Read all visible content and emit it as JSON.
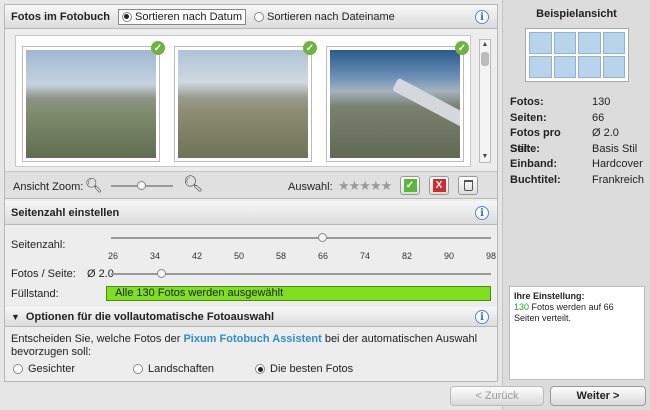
{
  "photos_section": {
    "title": "Fotos im Fotobuch",
    "sort_by_date": "Sortieren nach Datum",
    "sort_by_name": "Sortieren nach Dateiname"
  },
  "toolbar": {
    "zoom_label": "Ansicht Zoom:",
    "selection_label": "Auswahl:",
    "rating_stars": "★★★★★",
    "zoom_level": 0.5
  },
  "pages_section": {
    "title": "Seitenzahl einstellen",
    "pages_label": "Seitenzahl:",
    "ticks": [
      "26",
      "34",
      "42",
      "50",
      "58",
      "66",
      "74",
      "82",
      "90",
      "98"
    ],
    "pages_value": 66,
    "photos_per_page_label": "Fotos / Seite:",
    "photos_per_page_value": "Ø 2.0",
    "fill_label": "Füllstand:",
    "fill_text": "Alle 130 Fotos werden ausgewählt"
  },
  "options_section": {
    "title": "Optionen für die vollautomatische Fotoauswahl",
    "desc_before": "Entscheiden Sie, welche Fotos der ",
    "desc_brand": "Pixum Fotobuch Assistent",
    "desc_after": " bei der automatischen Auswahl bevorzugen soll:",
    "options": [
      "Gesichter",
      "Landschaften",
      "Die besten Fotos"
    ],
    "selected": "Die besten Fotos"
  },
  "sidebar": {
    "title": "Beispielansicht",
    "props": [
      {
        "key": "Fotos:",
        "value": "130"
      },
      {
        "key": "Seiten:",
        "value": "66"
      },
      {
        "key": "Fotos pro Seite:",
        "value": "Ø 2.0"
      },
      {
        "key": "Stil:",
        "value": "Basis Stil"
      },
      {
        "key": "Einband:",
        "value": "Hardcover"
      },
      {
        "key": "Buchtitel:",
        "value": "Frankreich"
      }
    ],
    "setting_title": "Ihre Einstellung:",
    "setting_count": "130",
    "setting_text": " Fotos werden auf 66 Seiten verteilt."
  },
  "nav": {
    "back": "< Zurück",
    "next": "Weiter >"
  },
  "icons": {
    "info": "i",
    "check": "✓",
    "close": "X",
    "zoom": "🔍"
  },
  "colors": {
    "fill_green": "#7ee01f",
    "brand_blue": "#2b8fc9",
    "check_green": "#6cb43f"
  }
}
